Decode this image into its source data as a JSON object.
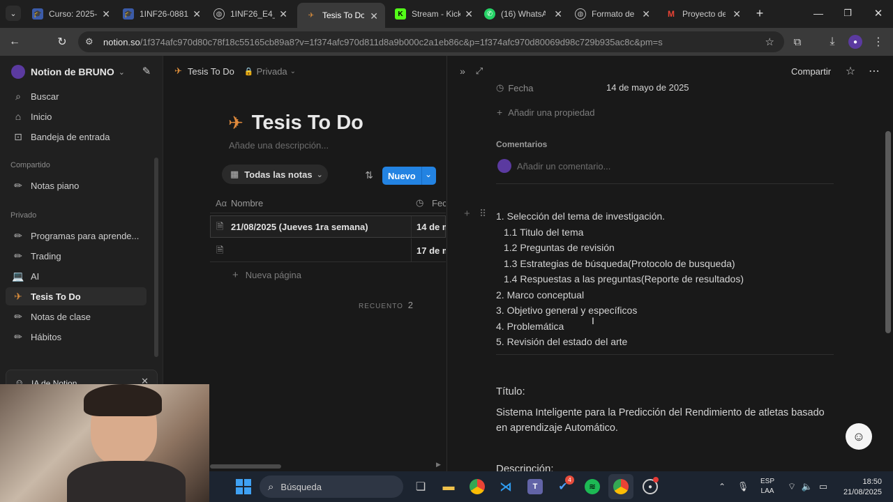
{
  "browser": {
    "tabs": [
      {
        "label": "Curso: 2025-",
        "icon": "graduation-cap-icon"
      },
      {
        "label": "1INF26-0881",
        "icon": "graduation-cap-icon"
      },
      {
        "label": "1INF26_E4_G",
        "icon": "globe-icon"
      },
      {
        "label": "Tesis To Do |",
        "icon": "notion-page-icon"
      },
      {
        "label": "Stream - Kick",
        "icon": "kick-icon"
      },
      {
        "label": "(16) WhatsA",
        "icon": "whatsapp-icon"
      },
      {
        "label": "Formato de",
        "icon": "globe-icon"
      },
      {
        "label": "Proyecto de",
        "icon": "gmail-icon"
      }
    ],
    "url_host": "notion.so",
    "url_path": "/1f374afc970d80c78f18c55165cb89a8?v=1f374afc970d811d8a9b000c2a1eb86c&p=1f374afc970d80069d98c729b935ac8c&pm=s"
  },
  "sidebar": {
    "workspace": "Notion de BRUNO",
    "items": [
      {
        "label": "Buscar",
        "icon": "search-icon"
      },
      {
        "label": "Inicio",
        "icon": "home-icon"
      },
      {
        "label": "Bandeja de entrada",
        "icon": "inbox-icon"
      }
    ],
    "shared_header": "Compartido",
    "shared": [
      {
        "label": "Notas piano",
        "icon": "pencil-icon"
      }
    ],
    "private_header": "Privado",
    "private": [
      {
        "label": "Programas para aprende...",
        "icon": "pencil-icon"
      },
      {
        "label": "Trading",
        "icon": "pencil-icon"
      },
      {
        "label": "AI",
        "icon": "laptop-icon"
      },
      {
        "label": "Tesis To Do",
        "icon": "airplane-icon"
      },
      {
        "label": "Notas de clase",
        "icon": "pencil-icon"
      },
      {
        "label": "Hábitos",
        "icon": "pencil-icon"
      }
    ],
    "ai_label": "IA de Notion"
  },
  "main": {
    "breadcrumb": "Tesis To Do",
    "privacy": "Privada",
    "title": "Tesis To Do",
    "description_placeholder": "Añade una descripción...",
    "view_label": "Todas las notas",
    "new_label": "Nuevo",
    "col_name": "Nombre",
    "col_date": "Fec",
    "rows": [
      {
        "name": "21/08/2025 (Jueves 1ra semana)",
        "date": "14 de m"
      },
      {
        "name": "",
        "date": "17 de m"
      }
    ],
    "new_page": "Nueva página",
    "count_label": "RECUENTO",
    "count_value": "2"
  },
  "panel": {
    "share_label": "Compartir",
    "prop_name": "Fecha",
    "prop_value": "14 de mayo de 2025",
    "add_property": "Añadir una propiedad",
    "comments_header": "Comentarios",
    "comment_placeholder": "Añadir un comentario...",
    "outline": [
      "1. Selección del tema de investigación.",
      "1.1 Titulo del tema",
      "1.2 Preguntas de revisión",
      "1.3 Estrategias de búsqueda(Protocolo de busqueda)",
      "1.4 Respuestas a las preguntas(Reporte de resultados)",
      "2. Marco conceptual",
      "3. Objetivo general y específicos",
      "4. Problemática",
      "5. Revisión del estado del arte"
    ],
    "title_label": "Título:",
    "title_text": "Sistema Inteligente para la Predicción del Rendimiento de atletas basado en aprendizaje Automático.",
    "desc_label": "Descripción:"
  },
  "taskbar": {
    "search_label": "Búsqueda",
    "lang_top": "ESP",
    "lang_bottom": "LAA",
    "time": "18:50",
    "date": "21/08/2025",
    "teams_badge": "4"
  }
}
